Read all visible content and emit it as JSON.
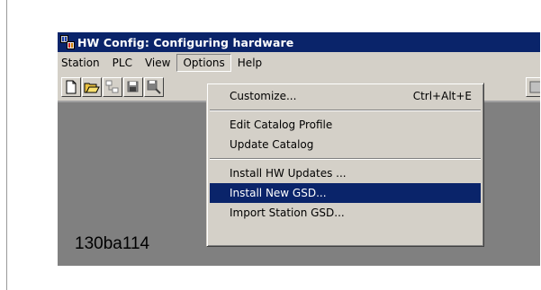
{
  "window": {
    "title": "HW Config: Configuring hardware",
    "icon": "hw-config-app-icon"
  },
  "menubar": {
    "items": [
      "Station",
      "PLC",
      "View",
      "Options",
      "Help"
    ],
    "open_menu": "Options"
  },
  "toolbar": {
    "buttons": [
      "new-icon",
      "open-icon",
      "station-properties-icon",
      "save-icon",
      "save-compile-icon",
      "download-icon"
    ]
  },
  "options_menu": {
    "customize_label": "Customize...",
    "customize_shortcut": "Ctrl+Alt+E",
    "edit_catalog_profile_label": "Edit Catalog Profile",
    "update_catalog_label": "Update Catalog",
    "install_hw_updates_label": "Install HW Updates ...",
    "install_new_gsd_label": "Install New GSD...",
    "import_station_gsd_label": "Import Station GSD...",
    "highlighted_item": "Install New GSD..."
  },
  "figure_id": "130ba114",
  "colors": {
    "titlebar": "#0a246a",
    "face": "#d4d0c8",
    "workarea": "#808080",
    "highlight": "#0a246a"
  }
}
